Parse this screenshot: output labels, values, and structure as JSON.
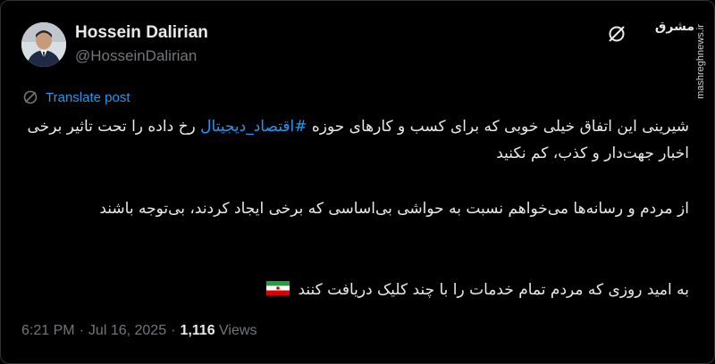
{
  "author": {
    "display_name": "Hossein Dalirian",
    "handle": "@HosseinDalirian"
  },
  "watermark": {
    "site": "mashreghnews.ir",
    "logo_text": "مشرق"
  },
  "translate": {
    "label": "Translate post"
  },
  "tweet": {
    "p1_before": "شیرینی این اتفاق خیلی خوبی که برای کسب و کارهای حوزه",
    "p1_hashtag": "#اقتصاد_دیجیتال",
    "p1_after": "رخ داده را تحت تاثیر برخی اخبار جهت‌دار و کذب، کم نکنید",
    "p2": "از مردم و رسانه‌ها می‌خواهم نسبت به حواشی بی‌اساسی که برخی ایجاد کردند، بی‌توجه باشند",
    "p3": "به امید روزی که مردم تمام خدمات را با چند کلیک دریافت کنند"
  },
  "meta": {
    "time": "6:21 PM",
    "separator": "·",
    "date": "Jul 16, 2025",
    "views_count": "1,116",
    "views_label": "Views"
  },
  "colors": {
    "background": "#000000",
    "text": "#e7e9ea",
    "muted": "#71767b",
    "link": "#1d9bf0",
    "border": "#2f3336"
  },
  "icons": {
    "translate": "translate-icon",
    "flag": "iran-flag-icon",
    "watermark_slash": "slash-circle-icon"
  }
}
